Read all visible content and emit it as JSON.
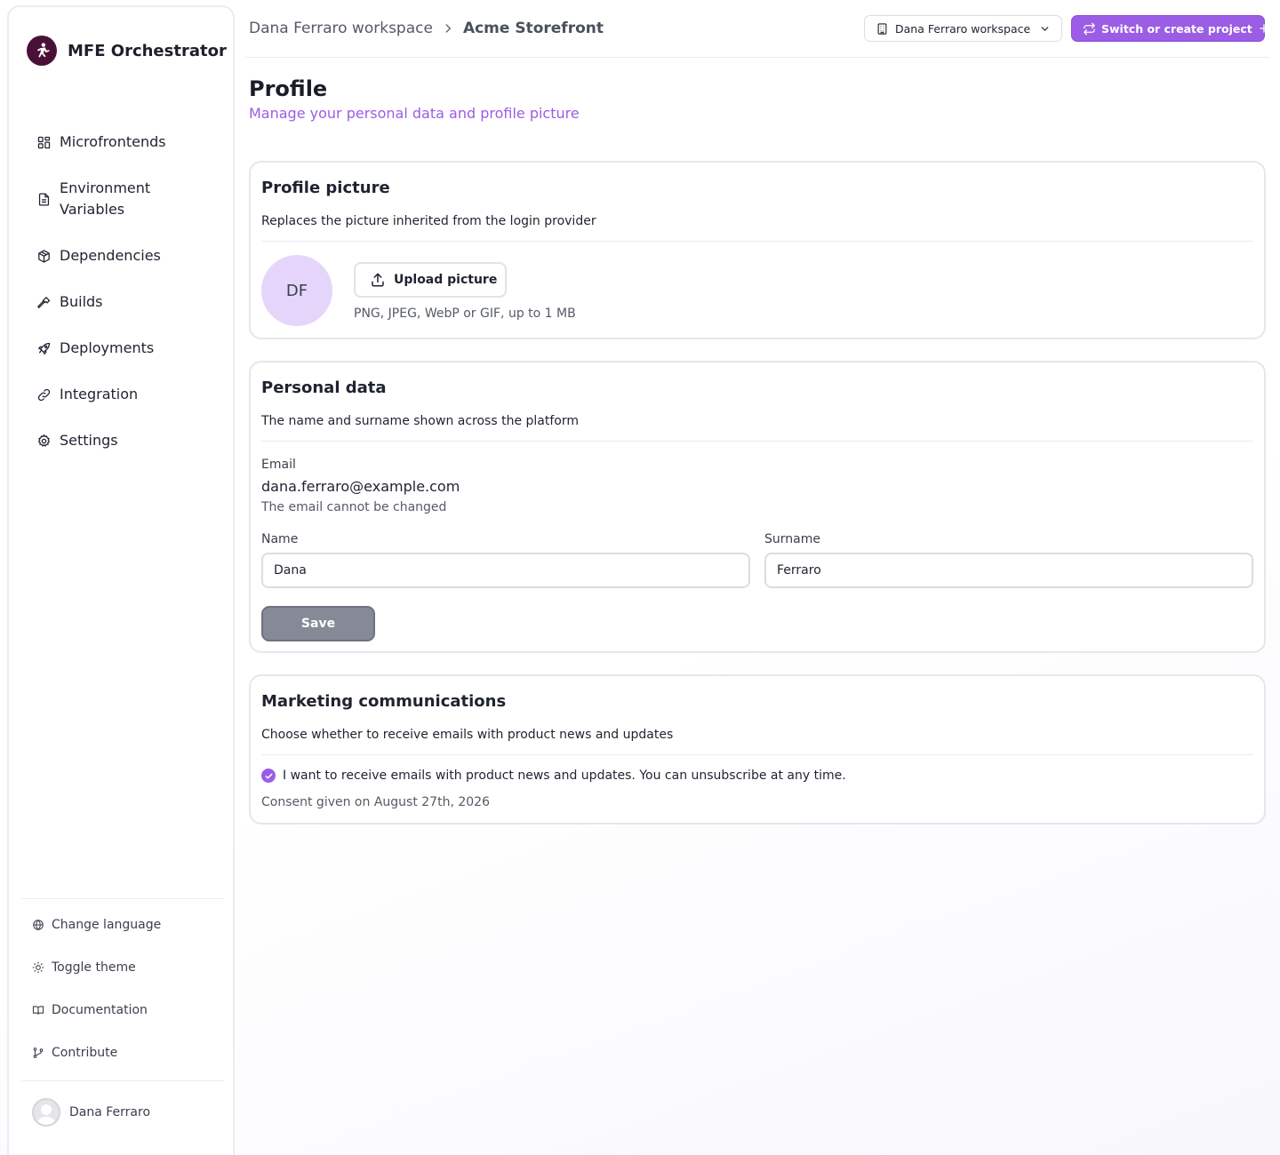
{
  "app": {
    "name": "MFE Orchestrator"
  },
  "breadcrumb": {
    "workspace": "Dana Ferraro workspace",
    "project": "Acme Storefront"
  },
  "topbar": {
    "workspace_select": "Dana Ferraro workspace",
    "switch_button": "Switch or create project",
    "accent": "#9b5de5"
  },
  "sidebar": {
    "items": [
      {
        "label": "Microfrontends",
        "icon": "grid-icon"
      },
      {
        "label": "Environment Variables",
        "icon": "file-text-icon"
      },
      {
        "label": "Dependencies",
        "icon": "package-icon"
      },
      {
        "label": "Builds",
        "icon": "hammer-icon"
      },
      {
        "label": "Deployments",
        "icon": "rocket-icon"
      },
      {
        "label": "Integration",
        "icon": "link-icon"
      },
      {
        "label": "Settings",
        "icon": "gear-icon"
      }
    ],
    "footer": [
      {
        "label": "Change language",
        "icon": "globe-icon"
      },
      {
        "label": "Toggle theme",
        "icon": "sun-icon"
      },
      {
        "label": "Documentation",
        "icon": "book-icon"
      },
      {
        "label": "Contribute",
        "icon": "git-branch-icon"
      }
    ],
    "user": {
      "name": "Dana Ferraro"
    }
  },
  "page": {
    "title": "Profile",
    "subtitle": "Manage your personal data and profile picture"
  },
  "profile_picture": {
    "title": "Profile picture",
    "description": "Replaces the picture inherited from the login provider",
    "initials": "DF",
    "upload_label": "Upload picture",
    "hint": "PNG, JPEG, WebP or GIF, up to 1 MB"
  },
  "personal_data": {
    "title": "Personal data",
    "description": "The name and surname shown across the platform",
    "email_label": "Email",
    "email_value": "dana.ferraro@example.com",
    "email_help": "The email cannot be changed",
    "name_label": "Name",
    "name_value": "Dana",
    "surname_label": "Surname",
    "surname_value": "Ferraro",
    "save_label": "Save"
  },
  "marketing": {
    "title": "Marketing communications",
    "description": "Choose whether to receive emails with product news and updates",
    "consent_label": "I want to receive emails with product news and updates. You can unsubscribe at any time.",
    "consent_checked": true,
    "consent_date": "Consent given on August 27th, 2026"
  }
}
